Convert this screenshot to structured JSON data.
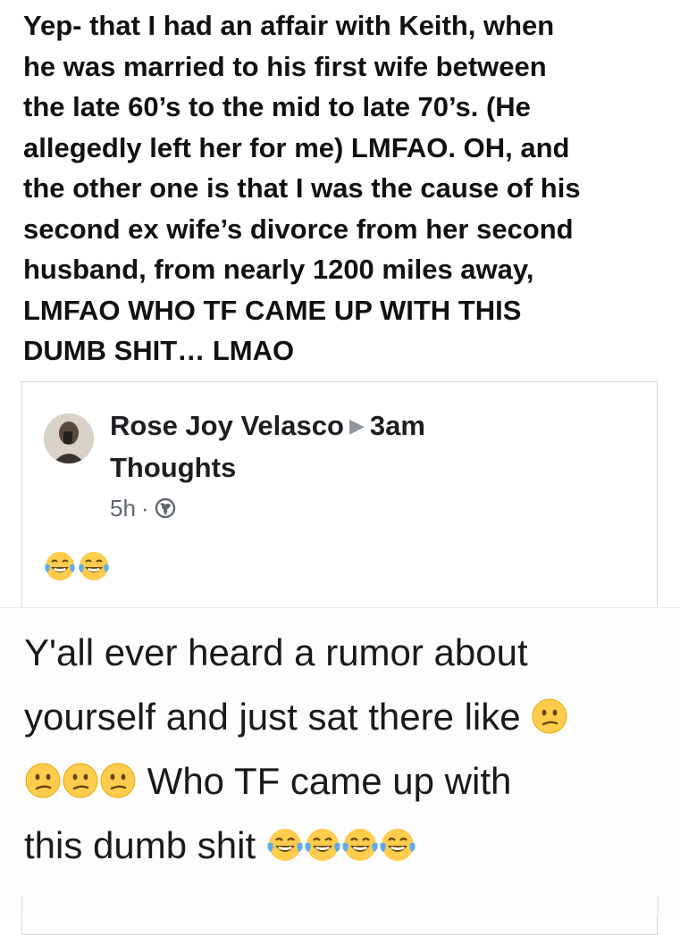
{
  "post": {
    "text": "Yep- that I had an affair with Keith, when\nhe was married to his first wife between\nthe late 60’s to the mid to late  70’s. (He\nallegedly left her for me) LMFAO.  OH, and\nthe other one is that I was the cause of his\nsecond ex wife’s divorce from her second\nhusband, from nearly 1200 miles away,\nLMFAO WHO TF CAME UP WITH THIS\nDUMB SHIT… LMAO"
  },
  "shared_post": {
    "author": "Rose Joy Velasco",
    "target": "3am",
    "target_line2": "Thoughts",
    "time": "5h",
    "dot": "·",
    "icons": {
      "privacy": "globe-icon",
      "reaction": "tears-of-joy-emoji"
    }
  },
  "image_text": {
    "line1": "Y'all ever heard a rumor about",
    "line2": "yourself and just sat there like",
    "line3": "Who TF came up with",
    "line4": "this dumb shit"
  },
  "colors": {
    "text": "#111111",
    "meta": "#606770",
    "border": "#d3d6db",
    "emoji_yellow": "#ffcc4d"
  }
}
